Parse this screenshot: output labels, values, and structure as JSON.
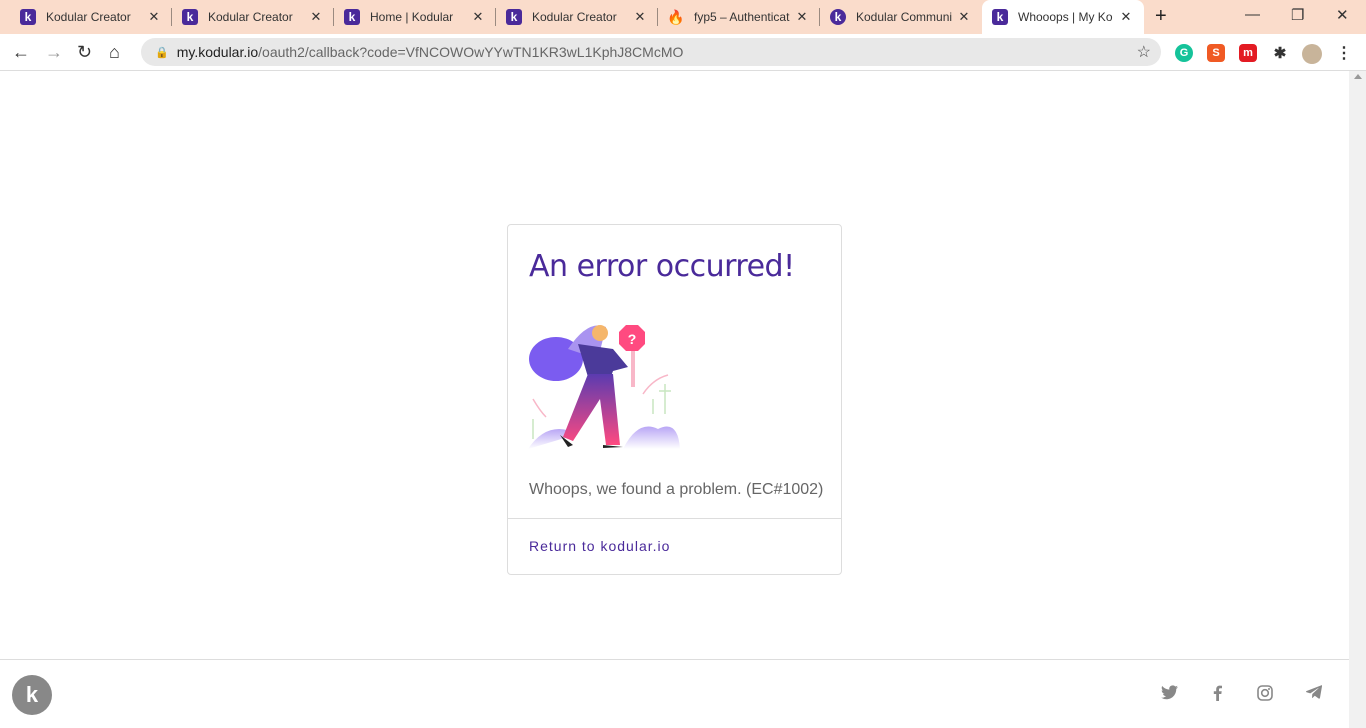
{
  "tabs": [
    {
      "title": "Kodular Creator",
      "icon": "k"
    },
    {
      "title": "Kodular Creator",
      "icon": "k"
    },
    {
      "title": "Home | Kodular",
      "icon": "k"
    },
    {
      "title": "Kodular Creator",
      "icon": "k"
    },
    {
      "title": "fyp5 – Authenticat",
      "icon": "🔥"
    },
    {
      "title": "Kodular Communi",
      "icon": "k"
    },
    {
      "title": "Whooops | My Ko",
      "icon": "k"
    }
  ],
  "address": {
    "host": "my.kodular.io",
    "path": "/oauth2/callback?code=VfNCOWOwYYwTN1KR3wL1KphJ8CMcMO"
  },
  "card": {
    "title": "An error occurred!",
    "message": "Whoops, we found a problem. (EC#1002)",
    "link": "Return to kodular.io"
  },
  "footer": {
    "logo": "k"
  }
}
